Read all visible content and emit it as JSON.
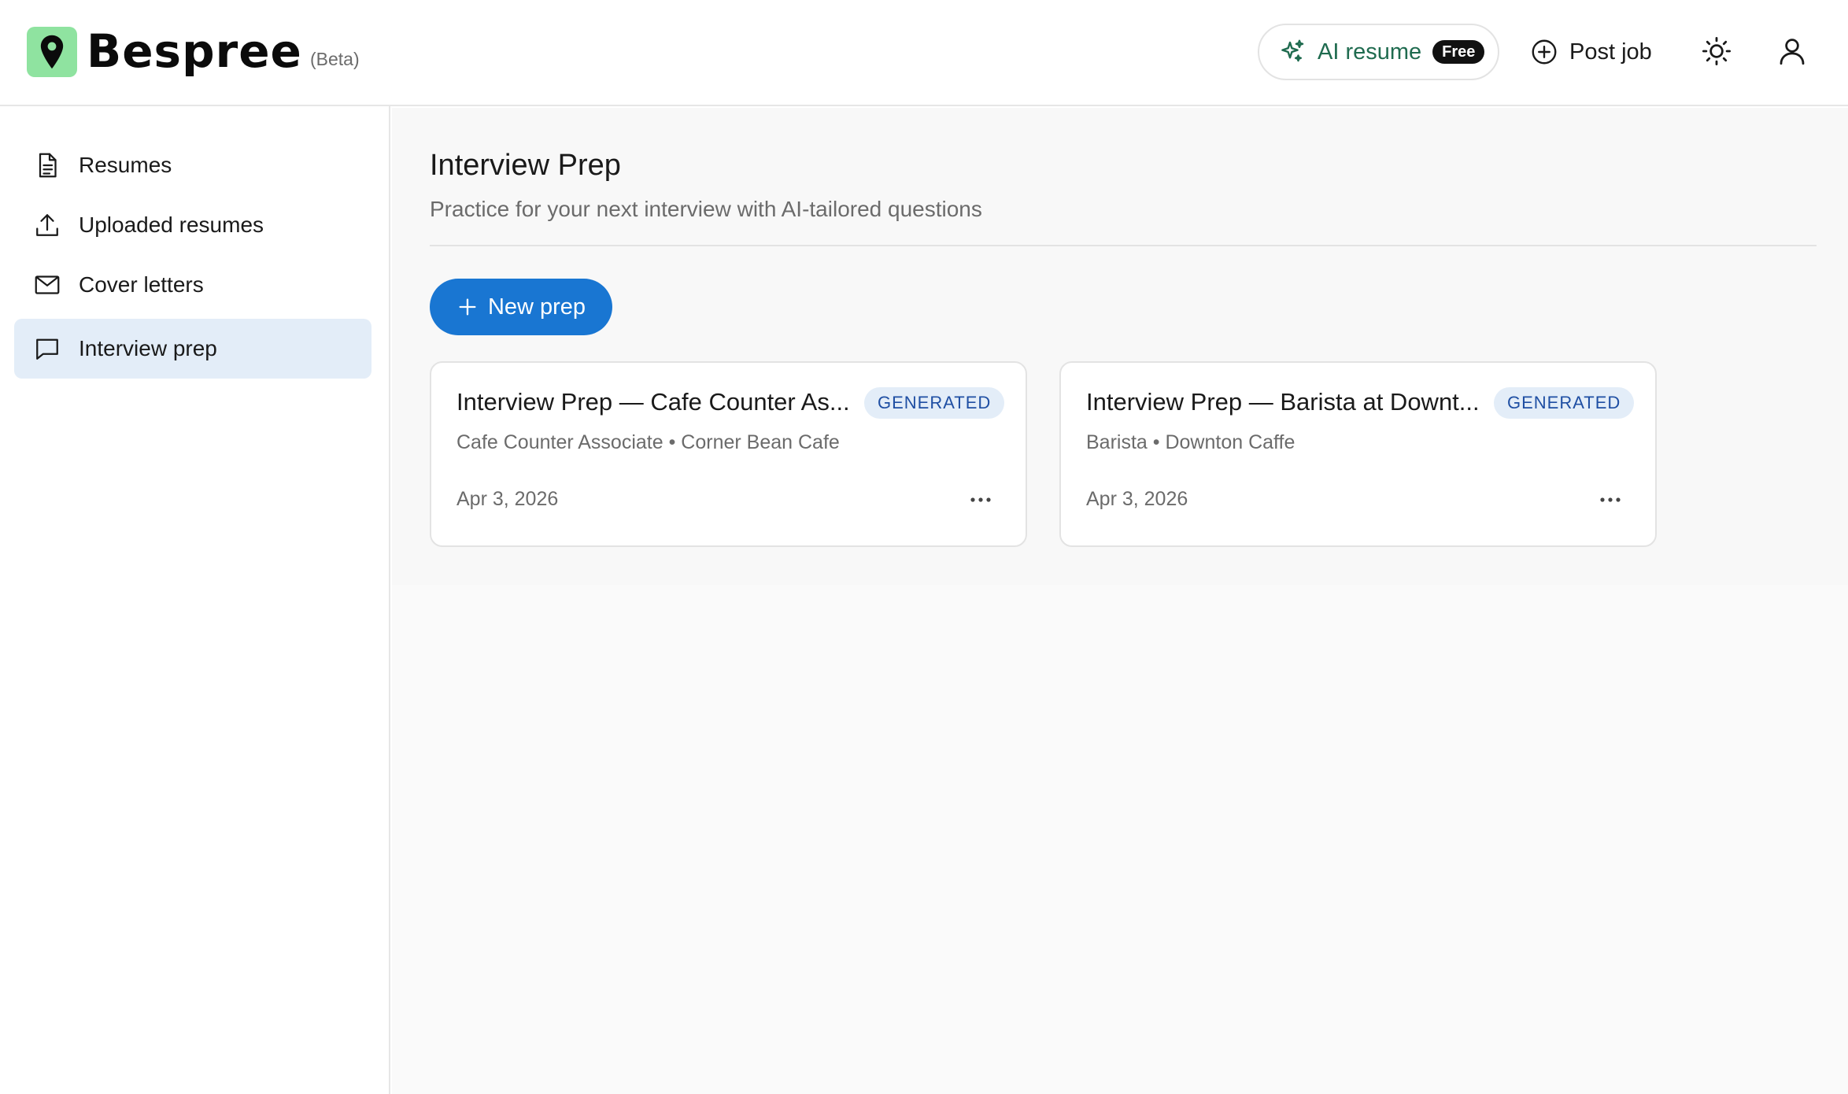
{
  "brand": {
    "name": "Bespree",
    "tag": "(Beta)",
    "logo_icon": "map-pin-icon",
    "logo_color": "#8fe3a0"
  },
  "header": {
    "ai_resume": {
      "label": "AI resume",
      "badge": "Free",
      "icon": "sparkles-icon",
      "color": "#1f6b4f"
    },
    "post_job": {
      "label": "Post job",
      "icon": "plus-circle-icon"
    },
    "theme_icon": "sun-icon",
    "user_icon": "user-icon"
  },
  "sidebar": {
    "items": [
      {
        "label": "Resumes",
        "icon": "document-icon",
        "active": false
      },
      {
        "label": "Uploaded resumes",
        "icon": "upload-icon",
        "active": false
      },
      {
        "label": "Cover letters",
        "icon": "mail-icon",
        "active": false
      },
      {
        "label": "Interview prep",
        "icon": "chat-bubble-icon",
        "active": true
      }
    ],
    "active_bg": "#e3edf8"
  },
  "main": {
    "title": "Interview Prep",
    "subtitle": "Practice for your next interview with AI-tailored questions",
    "new_button": {
      "label": "New prep",
      "color": "#1976d2"
    },
    "cards": [
      {
        "title": "Interview Prep — Cafe Counter As...",
        "badge": "GENERATED",
        "subtitle": "Cafe Counter Associate • Corner Bean Cafe",
        "date": "Apr 3, 2026"
      },
      {
        "title": "Interview Prep — Barista at Downt...",
        "badge": "GENERATED",
        "subtitle": "Barista • Downton Caffe",
        "date": "Apr 3, 2026"
      }
    ]
  }
}
